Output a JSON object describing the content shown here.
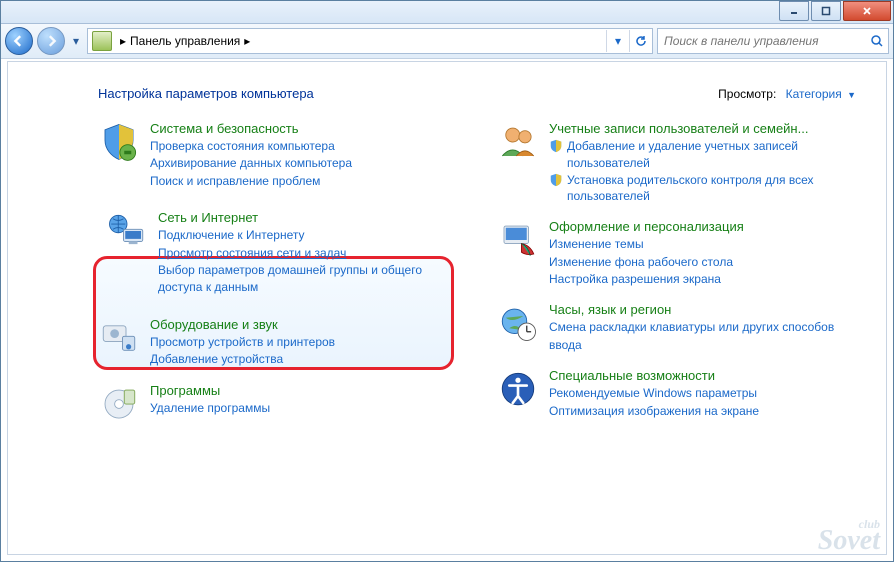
{
  "breadcrumb": {
    "root": "Панель управления"
  },
  "search": {
    "placeholder": "Поиск в панели управления"
  },
  "heading": "Настройка параметров компьютера",
  "view": {
    "label": "Просмотр:",
    "value": "Категория"
  },
  "left": [
    {
      "title": "Система и безопасность",
      "links": [
        "Проверка состояния компьютера",
        "Архивирование данных компьютера",
        "Поиск и исправление проблем"
      ]
    },
    {
      "title": "Сеть и Интернет",
      "links": [
        "Подключение к Интернету",
        "Просмотр состояния сети и задач",
        "Выбор параметров домашней группы и общего доступа к данным"
      ]
    },
    {
      "title": "Оборудование и звук",
      "links": [
        "Просмотр устройств и принтеров",
        "Добавление устройства"
      ]
    },
    {
      "title": "Программы",
      "links": [
        "Удаление программы"
      ]
    }
  ],
  "right": [
    {
      "title": "Учетные записи пользователей и семейн...",
      "shielded": [
        "Добавление и удаление учетных записей пользователей",
        "Установка родительского контроля для всех пользователей"
      ]
    },
    {
      "title": "Оформление и персонализация",
      "links": [
        "Изменение темы",
        "Изменение фона рабочего стола",
        "Настройка разрешения экрана"
      ]
    },
    {
      "title": "Часы, язык и регион",
      "links": [
        "Смена раскладки клавиатуры или других способов ввода"
      ]
    },
    {
      "title": "Специальные возможности",
      "links": [
        "Рекомендуемые Windows параметры",
        "Оптимизация изображения на экране"
      ]
    }
  ],
  "watermark": {
    "top": "club",
    "main": "Sovet"
  }
}
